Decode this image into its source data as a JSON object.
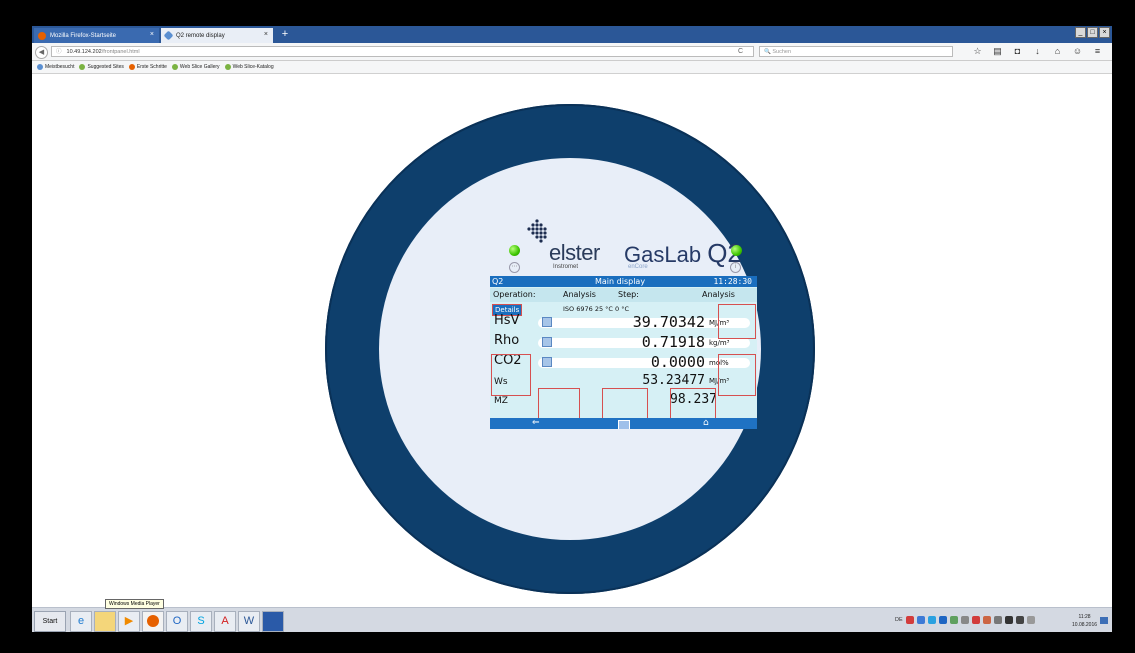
{
  "browser": {
    "tabs": [
      {
        "label": "Mozilla Firefox-Startseite",
        "close": "×"
      },
      {
        "label": "Q2 remote display",
        "close": "×"
      }
    ],
    "new_tab": "+",
    "window_controls": [
      "_",
      "□",
      "×"
    ],
    "url": "10.49.124.202",
    "url_path": "/frontpanel.html",
    "reload": "C",
    "search_placeholder": "Suchen",
    "nav_icons": [
      "star-icon",
      "reading-list-icon",
      "pocket-icon",
      "download-icon",
      "home-icon",
      "chat-icon",
      "menu-icon"
    ],
    "bookmarks": [
      "Meistbesucht",
      "Suggested Sites",
      "Erste Schritte",
      "Web Slice Gallery",
      "Web Slice-Katalog"
    ]
  },
  "device": {
    "brand": "elster",
    "brand_sub": "Instromet",
    "product": "GasLab",
    "product_model": "Q2",
    "product_sub": "enCore",
    "panel": {
      "header_left": "Q2",
      "header_center": "Main display",
      "time": "11:28:30",
      "status": {
        "operation_label": "Operation:",
        "operation_value": "Analysis",
        "step_label": "Step:",
        "step_value": "Analysis"
      },
      "details_label": "Details",
      "standard": "ISO 6976  25 °C  0 °C",
      "rows": [
        {
          "name": "HsV",
          "value": "39.70342",
          "unit": "MJ/m³"
        },
        {
          "name": "Rho",
          "value": "0.71918",
          "unit": "kg/m³"
        },
        {
          "name": "CO2",
          "value": "0.0000",
          "unit": "mol%"
        },
        {
          "name": "Ws",
          "value": "53.23477",
          "unit": "MJ/m³"
        },
        {
          "name": "MZ",
          "value": "98.237",
          "unit": ""
        }
      ],
      "footer": {
        "back": "⇐",
        "home": "⌂"
      }
    }
  },
  "taskbar": {
    "start": "Start",
    "tooltip": "Windows Media Player",
    "language": "DE",
    "clock_time": "11:28",
    "clock_date": "10.08.2016"
  }
}
